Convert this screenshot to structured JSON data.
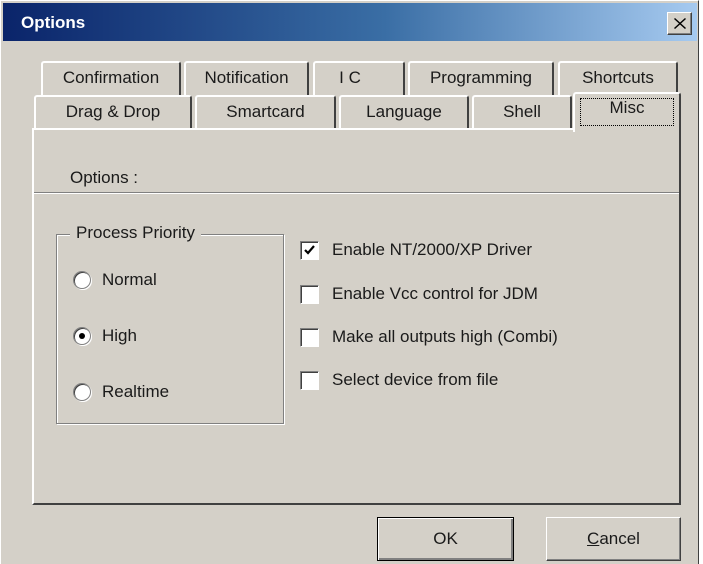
{
  "window": {
    "title": "Options"
  },
  "tabs": {
    "row_back": [
      "Confirmation",
      "Notification",
      "I C",
      "Programming",
      "Shortcuts"
    ],
    "row_front": [
      "Drag & Drop",
      "Smartcard",
      "Language",
      "Shell",
      "Misc"
    ],
    "selected": "Misc"
  },
  "panel": {
    "section_label": "Options :",
    "priority_group": {
      "label": "Process Priority",
      "options": [
        "Normal",
        "High",
        "Realtime"
      ],
      "selected": "High"
    },
    "checkboxes": [
      {
        "label": "Enable NT/2000/XP Driver",
        "checked": true
      },
      {
        "label": "Enable Vcc control for JDM",
        "checked": false
      },
      {
        "label": "Make all outputs high (Combi)",
        "checked": false
      },
      {
        "label": "Select device from file",
        "checked": false
      }
    ]
  },
  "buttons": {
    "ok": "OK",
    "cancel_first": "C",
    "cancel_rest": "ancel"
  },
  "icons": {
    "close": "close-icon",
    "check": "check-icon"
  }
}
